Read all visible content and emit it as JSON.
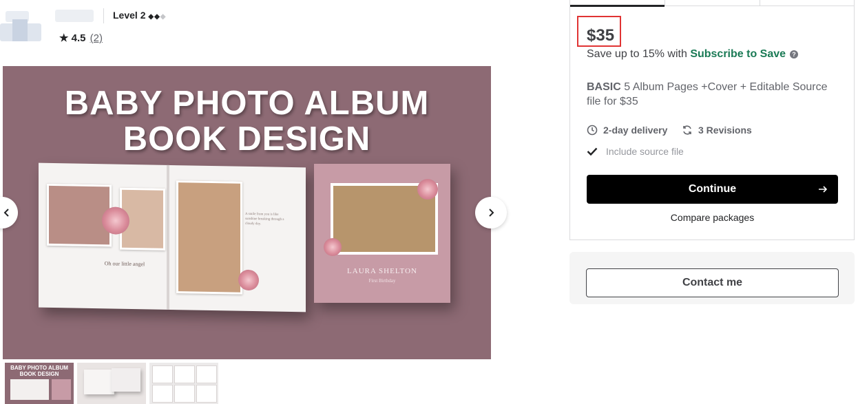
{
  "seller": {
    "level_label": "Level 2",
    "level_diamonds": "◆◆",
    "level_diamond_off": "◆",
    "rating": "4.5",
    "review_count": "(2)"
  },
  "gallery": {
    "image_title_line1": "BABY PHOTO ALBUM",
    "image_title_line2": "BOOK DESIGN",
    "open_book_caption": "Oh our little angel",
    "open_book_quote": "A smile from you is like sunshine breaking through a cloudy day.",
    "cover_name": "LAURA SHELTON",
    "cover_subtitle": "First Birthday",
    "thumbnails": [
      {
        "caption_line1": "BABY PHOTO ALBUM",
        "caption_line2": "BOOK DESIGN"
      },
      {},
      {}
    ]
  },
  "package": {
    "price": "$35",
    "save_prefix": "Save up to 15% with ",
    "subscribe_link": "Subscribe to Save",
    "help_glyph": "?",
    "tier": "BASIC",
    "description": " 5 Album Pages +Cover + Editable Source file for $35",
    "delivery": "2-day delivery",
    "revisions": "3 Revisions",
    "features": [
      "Include source file"
    ],
    "continue_label": "Continue",
    "compare_label": "Compare packages"
  },
  "contact": {
    "label": "Contact me"
  },
  "colors": {
    "accent_green": "#1a7a55",
    "highlight_box": "#e03333"
  }
}
